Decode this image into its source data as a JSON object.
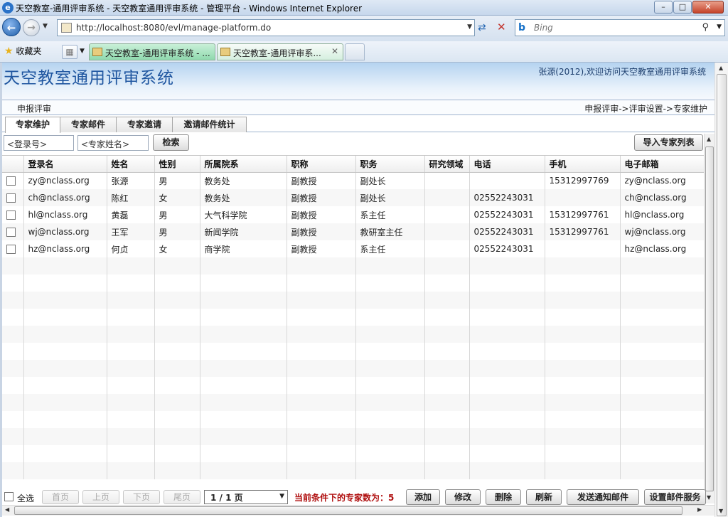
{
  "browser": {
    "window_title": "天空教室-通用评审系统 - 天空教室通用评审系统 - 管理平台 - Windows Internet Explorer",
    "address": "http://localhost:8080/evl/manage-platform.do",
    "search_placeholder": "Bing",
    "favorites_label": "收藏夹",
    "tabs": [
      {
        "label": "天空教室-通用评审系统 - ..."
      },
      {
        "label": "天空教室-通用评审系..."
      }
    ]
  },
  "app": {
    "title": "天空教室通用评审系统",
    "welcome": "张源(2012),欢迎访问天空教室通用评审系统",
    "menu_item": "申报评审",
    "breadcrumb": "申报评审->评审设置->专家维护",
    "tabs": [
      "专家维护",
      "专家邮件",
      "专家邀请",
      "邀请邮件统计"
    ],
    "active_tab": "专家维护"
  },
  "filter": {
    "login_placeholder": "<登录号>",
    "name_placeholder": "<专家姓名>",
    "search_label": "检索",
    "import_label": "导入专家列表"
  },
  "table": {
    "columns": [
      "登录名",
      "姓名",
      "性别",
      "所属院系",
      "职称",
      "职务",
      "研究领域",
      "电话",
      "手机",
      "电子邮箱"
    ],
    "rows": [
      [
        "zy@nclass.org",
        "张源",
        "男",
        "教务处",
        "副教授",
        "副处长",
        "",
        "",
        "15312997769",
        "zy@nclass.org"
      ],
      [
        "ch@nclass.org",
        "陈红",
        "女",
        "教务处",
        "副教授",
        "副处长",
        "",
        "02552243031",
        "",
        "ch@nclass.org"
      ],
      [
        "hl@nclass.org",
        "黄磊",
        "男",
        "大气科学院",
        "副教授",
        "系主任",
        "",
        "02552243031",
        "15312997761",
        "hl@nclass.org"
      ],
      [
        "wj@nclass.org",
        "王军",
        "男",
        "新闻学院",
        "副教授",
        "教研室主任",
        "",
        "02552243031",
        "15312997761",
        "wj@nclass.org"
      ],
      [
        "hz@nclass.org",
        "何贞",
        "女",
        "商学院",
        "副教授",
        "系主任",
        "",
        "02552243031",
        "",
        "hz@nclass.org"
      ]
    ]
  },
  "pager": {
    "select_all": "全选",
    "first": "首页",
    "prev": "上页",
    "next": "下页",
    "last": "尾页",
    "page": "1 / 1 页",
    "count_text": "当前条件下的专家数为：5",
    "add": "添加",
    "edit": "修改",
    "delete": "删除",
    "refresh": "刷新",
    "send_notice": "发送通知邮件",
    "mail_settings": "设置邮件服务"
  }
}
